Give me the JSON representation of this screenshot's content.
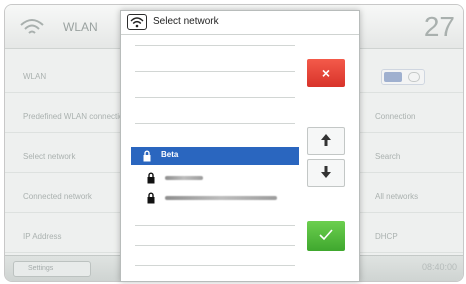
{
  "background": {
    "title": "WLAN",
    "temperature": "27",
    "rows": [
      {
        "label": "WLAN",
        "value": ""
      },
      {
        "label": "Predefined WLAN connection",
        "value": "Connection"
      },
      {
        "label": "Select network",
        "value": "Search"
      },
      {
        "label": "Connected network",
        "value": "All networks"
      },
      {
        "label": "IP Address",
        "value": "DHCP"
      }
    ],
    "back_label": "Settings",
    "time": "08:40:00"
  },
  "dialog": {
    "title": "Select network",
    "networks": [
      {
        "name": "Beta",
        "selected": true
      },
      {
        "name": "",
        "selected": false
      },
      {
        "name": "",
        "selected": false
      }
    ],
    "cancel_label": "×"
  },
  "colors": {
    "selected": "#2a66bf",
    "cancel": "#e6402f",
    "confirm": "#52bb3c"
  }
}
